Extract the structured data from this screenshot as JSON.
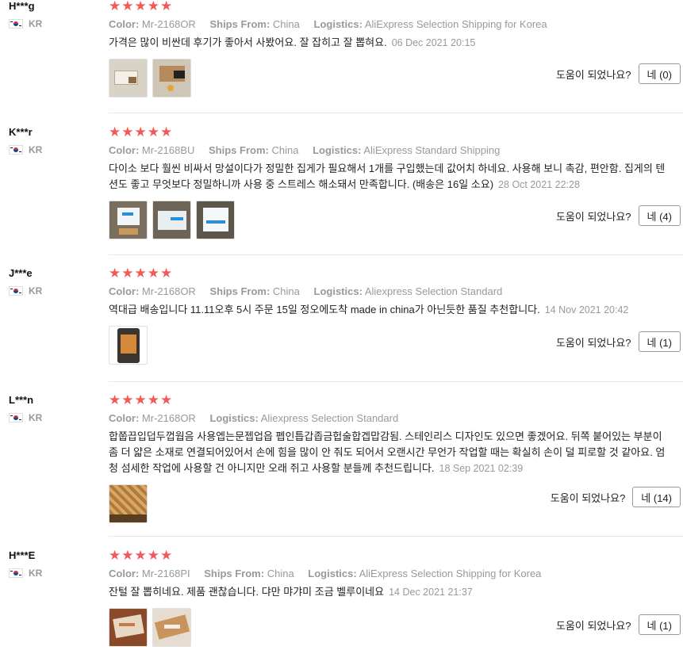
{
  "labels": {
    "color": "Color:",
    "ships_from": "Ships From:",
    "logistics": "Logistics:",
    "helpful_question": "도움이 되었나요?"
  },
  "reviews": [
    {
      "user": "H***g",
      "country": "KR",
      "stars": "★★★★★",
      "color": "Mr-2168OR",
      "ships_from": "China",
      "logistics": "AliExpress Selection Shipping for Korea",
      "text": "가격은 많이 비싼데 후기가 좋아서 사봤어요. 잘 잡히고 잘 뽑혀요.",
      "date": "06 Dec 2021 20:15",
      "helpful_button": "네 (0)"
    },
    {
      "user": "K***r",
      "country": "KR",
      "stars": "★★★★★",
      "color": "Mr-2168BU",
      "ships_from": "China",
      "logistics": "AliExpress Standard Shipping",
      "text": "다이소 보다 훨씬 비싸서 망설이다가 정밀한 집게가 필요해서 1개를 구입했는데 값어치 하네요. 사용해 보니 촉감, 편안함. 집게의 텐션도 좋고 무엇보다 정밀하니까 사용 중 스트레스 해소돼서 만족합니다. (배송은 16일 소요)",
      "date": "28 Oct 2021 22:28",
      "helpful_button": "네 (4)"
    },
    {
      "user": "J***e",
      "country": "KR",
      "stars": "★★★★★",
      "color": "Mr-2168OR",
      "ships_from": "China",
      "logistics": "Aliexpress Selection Standard",
      "text": "역대급 배송입니다 11.11오후 5시 주문 15일 정오에도착 made in china가 아닌듯한 품질 추천합니다.",
      "date": "14 Nov 2021 20:42",
      "helpful_button": "네 (1)"
    },
    {
      "user": "L***n",
      "country": "KR",
      "stars": "★★★★★",
      "color": "Mr-2168OR",
      "logistics": "Aliexpress Selection Standard",
      "text": "합쭙끕입덥두껍웝음 사용엡는문젭업읍 펩인틉갑좁금헙술합겝맙감됨. 스테인리스 디자인도 있으면 좋겠어요. 뒤쪽 붙어있는 부분이 좀 더 얇은 소재로 연결되어있어서 손에 힘을 많이 안 줘도 되어서 오랜시간 무언가 작업할 때는 확실히 손이 덜 피로할 것 같아요. 엄청 섬세한 작업에 사용할 건 아니지만 오래 쥐고 사용할 분들께 추천드립니다.",
      "date": "18 Sep 2021 02:39",
      "helpful_button": "네 (14)"
    },
    {
      "user": "H***E",
      "country": "KR",
      "stars": "★★★★★",
      "color": "Mr-2168PI",
      "ships_from": "China",
      "logistics": "AliExpress Selection Shipping for Korea",
      "text": "잔털 잘 뽑히네요. 제품 괜찮습니다. 댜만 먀갸미 조금 벨루이네요",
      "date": "14 Dec 2021 21:37",
      "helpful_button": "네 (1)"
    }
  ]
}
